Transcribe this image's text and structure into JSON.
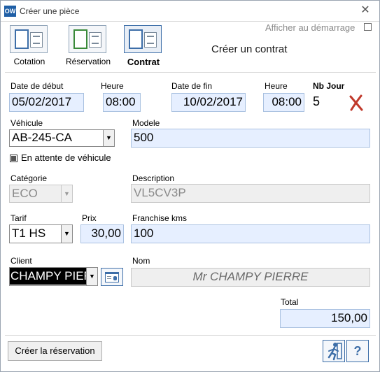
{
  "window": {
    "app_icon": "OW",
    "title": "Créer une pièce",
    "close_glyph": "✕"
  },
  "header": {
    "startup_label": "Afficher au démarrage",
    "tabs": [
      {
        "label": "Cotation",
        "icon": "cotation-icon"
      },
      {
        "label": "Réservation",
        "icon": "reservation-icon"
      },
      {
        "label": "Contrat",
        "icon": "contrat-icon",
        "active": true
      }
    ],
    "heading": "Créer un contrat"
  },
  "form": {
    "date_debut_label": "Date de début",
    "date_debut_value": "05/02/2017",
    "heure1_label": "Heure",
    "heure1_value": "08:00",
    "date_fin_label": "Date de fin",
    "date_fin_value": "10/02/2017",
    "heure2_label": "Heure",
    "heure2_value": "08:00",
    "nb_jour_label": "Nb Jour",
    "nb_jour_value": "5",
    "vehicule_label": "Véhicule",
    "vehicule_value": "AB-245-CA",
    "modele_label": "Modele",
    "modele_value": "500",
    "attente_label": "En attente de véhicule",
    "categorie_label": "Catégorie",
    "categorie_value": "ECO",
    "description_label": "Description",
    "description_value": "VL5CV3P",
    "tarif_label": "Tarif",
    "tarif_value": "T1 HS",
    "prix_label": "Prix",
    "prix_value": "30,00",
    "franchise_label": "Franchise kms",
    "franchise_value": "100",
    "client_label": "Client",
    "client_value": "CHAMPY PIERRE",
    "nom_label": "Nom",
    "nom_value": "Mr CHAMPY PIERRE",
    "total_label": "Total",
    "total_value": "150,00"
  },
  "footer": {
    "create_reservation_label": "Créer la réservation",
    "help_glyph": "?"
  },
  "colors": {
    "field_bg": "#e6efff",
    "field_border": "#a9c1e0",
    "delete_red": "#c0392b",
    "accent_blue": "#3d6ea8"
  }
}
